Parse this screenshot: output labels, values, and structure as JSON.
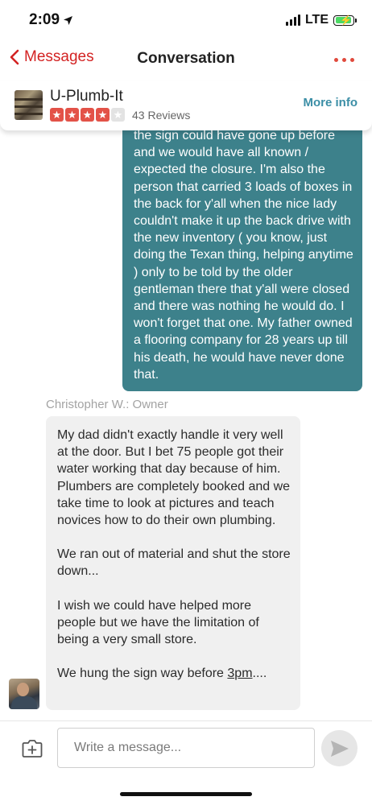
{
  "status_bar": {
    "time": "2:09",
    "network": "LTE"
  },
  "nav": {
    "back_label": "Messages",
    "title": "Conversation"
  },
  "business": {
    "name": "U-Plumb-It",
    "rating": 4,
    "rating_max": 5,
    "reviews": "43 Reviews",
    "more_info": "More info"
  },
  "outgoing": {
    "text": "the sign could have gone up before and we would have all known / expected the closure. I'm also the person that carried 3 loads of boxes in the back for y'all when the nice lady couldn't make it up the back drive with the new inventory ( you know, just doing the Texan thing, helping anytime ) only to be told by the older gentleman there that y'all were closed and there was nothing he would do. I won't forget that one. My father owned a flooring company for 28 years up till his death, he would have never done that."
  },
  "incoming": {
    "sender": "Christopher W.: Owner",
    "paragraphs": [
      "My dad didn't exactly handle it very well at the door. But I bet 75 people got their water working that day because of him. Plumbers are completely booked and we take time to look at pictures and teach novices how to do their own plumbing.",
      "We ran out of material and shut the store down...",
      "I wish we could have helped more people but we have the limitation of being a very small store."
    ],
    "last_line_prefix": "We hung the sign way before ",
    "last_line_link": "3pm",
    "last_line_suffix": "...."
  },
  "composer": {
    "placeholder": "Write a message..."
  },
  "colors": {
    "brand_red": "#d32323",
    "outgoing_bubble": "#3d818b",
    "incoming_bubble": "#f0f0f0",
    "link_blue": "#3b8ea6"
  },
  "icons": [
    "location-arrow-icon",
    "signal-icon",
    "battery-charging-icon",
    "chevron-left-icon",
    "more-dots-icon",
    "star-icon",
    "attach-photo-icon",
    "send-icon"
  ]
}
